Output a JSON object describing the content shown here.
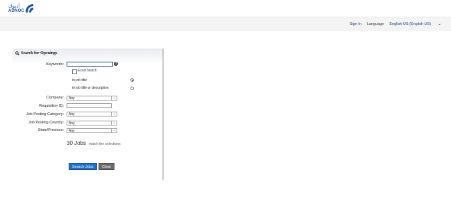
{
  "brand": {
    "name": "ADNOC",
    "arabic": "أدنوك"
  },
  "topbar": {
    "sign_in": "Sign In",
    "language_label": "Language",
    "language_value": "English US (English US)"
  },
  "search_panel": {
    "title": "Search for Openings",
    "keywords": {
      "label": "Keywords:",
      "value": ""
    },
    "exact_match_label": "Exact Match",
    "options": [
      {
        "label": "in job title",
        "selected": true
      },
      {
        "label": "in job title or description",
        "selected": false
      }
    ],
    "company": {
      "label": "Company:",
      "value": "Any"
    },
    "requisition": {
      "label": "Requisition ID:",
      "value": ""
    },
    "category": {
      "label": "Job Posting Category:",
      "value": "Any"
    },
    "country": {
      "label": "Job Posting Country:",
      "value": "Any"
    },
    "state": {
      "label": "State/Province:",
      "value": "Any"
    },
    "result_count": "30 Jobs",
    "result_text": "match the selections",
    "search_button": "Search Jobs",
    "clear_button": "Clear"
  }
}
